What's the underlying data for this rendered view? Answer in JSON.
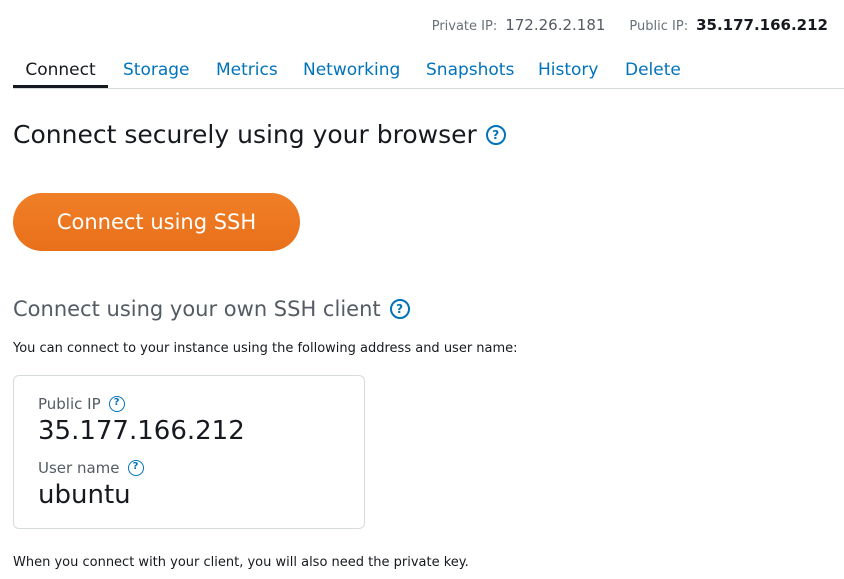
{
  "header": {
    "private_ip_label": "Private IP:",
    "private_ip": "172.26.2.181",
    "public_ip_label": "Public IP:",
    "public_ip": "35.177.166.212"
  },
  "tabs": [
    {
      "label": "Connect",
      "active": true
    },
    {
      "label": "Storage"
    },
    {
      "label": "Metrics"
    },
    {
      "label": "Networking"
    },
    {
      "label": "Snapshots"
    },
    {
      "label": "History"
    },
    {
      "label": "Delete"
    }
  ],
  "browser_section": {
    "title": "Connect securely using your browser",
    "button_label": "Connect using SSH"
  },
  "client_section": {
    "title": "Connect using your own SSH client",
    "description": "You can connect to your instance using the following address and user name:",
    "public_ip_label": "Public IP",
    "public_ip_value": "35.177.166.212",
    "user_name_label": "User name",
    "user_name_value": "ubuntu"
  },
  "footer_note": "When you connect with your client, you will also need the private key.",
  "icons": {
    "help": "?"
  },
  "colors": {
    "link": "#0073bb",
    "button_orange": "#ec7211",
    "text_dark": "#16191f",
    "text_muted": "#545b64"
  }
}
